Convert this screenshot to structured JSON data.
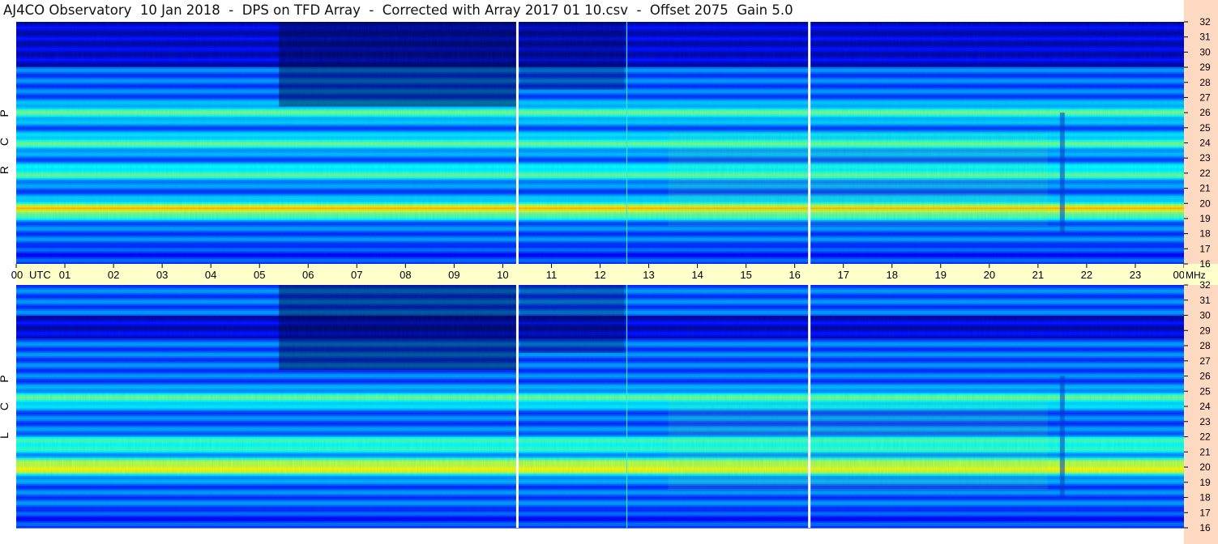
{
  "title": "AJ4CO Observatory  10 Jan 2018  -  DPS on TFD Array  -  Corrected with Array 2017 01 10.csv  -  Offset 2075  Gain 5.0",
  "colors": {
    "strip_bg": "#ffffcc",
    "freq_axis_bg": "#fcd9c0",
    "divider_line": "#ffffff",
    "cyan_line": "#40e0e0",
    "low": "#00007f",
    "mid": "#0080ff",
    "high": "#ffff00"
  },
  "chart_data": {
    "type": "heatmap",
    "panels": [
      {
        "name": "R C P",
        "polarization_letters": [
          "R",
          "C",
          "P"
        ],
        "strong_bands_MHz": [
          19.6,
          22,
          24,
          26
        ],
        "dark_band_MHz": [
          29,
          32
        ]
      },
      {
        "name": "L C P",
        "polarization_letters": [
          "L",
          "C",
          "P"
        ],
        "strong_bands_MHz": [
          20,
          24.5,
          21.5
        ],
        "dark_band_MHz": [
          28.5,
          30
        ]
      }
    ],
    "x_axis": {
      "unit_label": "UTC",
      "ticks": [
        "00",
        "01",
        "02",
        "03",
        "04",
        "05",
        "06",
        "07",
        "08",
        "09",
        "10",
        "11",
        "12",
        "13",
        "14",
        "15",
        "16",
        "17",
        "18",
        "19",
        "20",
        "21",
        "22",
        "23",
        "00"
      ],
      "range_hours": [
        0,
        24
      ]
    },
    "y_axis": {
      "unit_label": "MHz",
      "ticks": [
        32,
        31,
        30,
        29,
        28,
        27,
        26,
        25,
        24,
        23,
        22,
        21,
        20,
        19,
        18,
        17,
        16
      ],
      "range_MHz": [
        16,
        32
      ]
    },
    "white_gap_times_UTC": [
      10.3,
      16.3
    ],
    "cyan_line_time_UTC": 12.55,
    "colormap": "blue-cyan-yellow-red (jet-like)"
  }
}
